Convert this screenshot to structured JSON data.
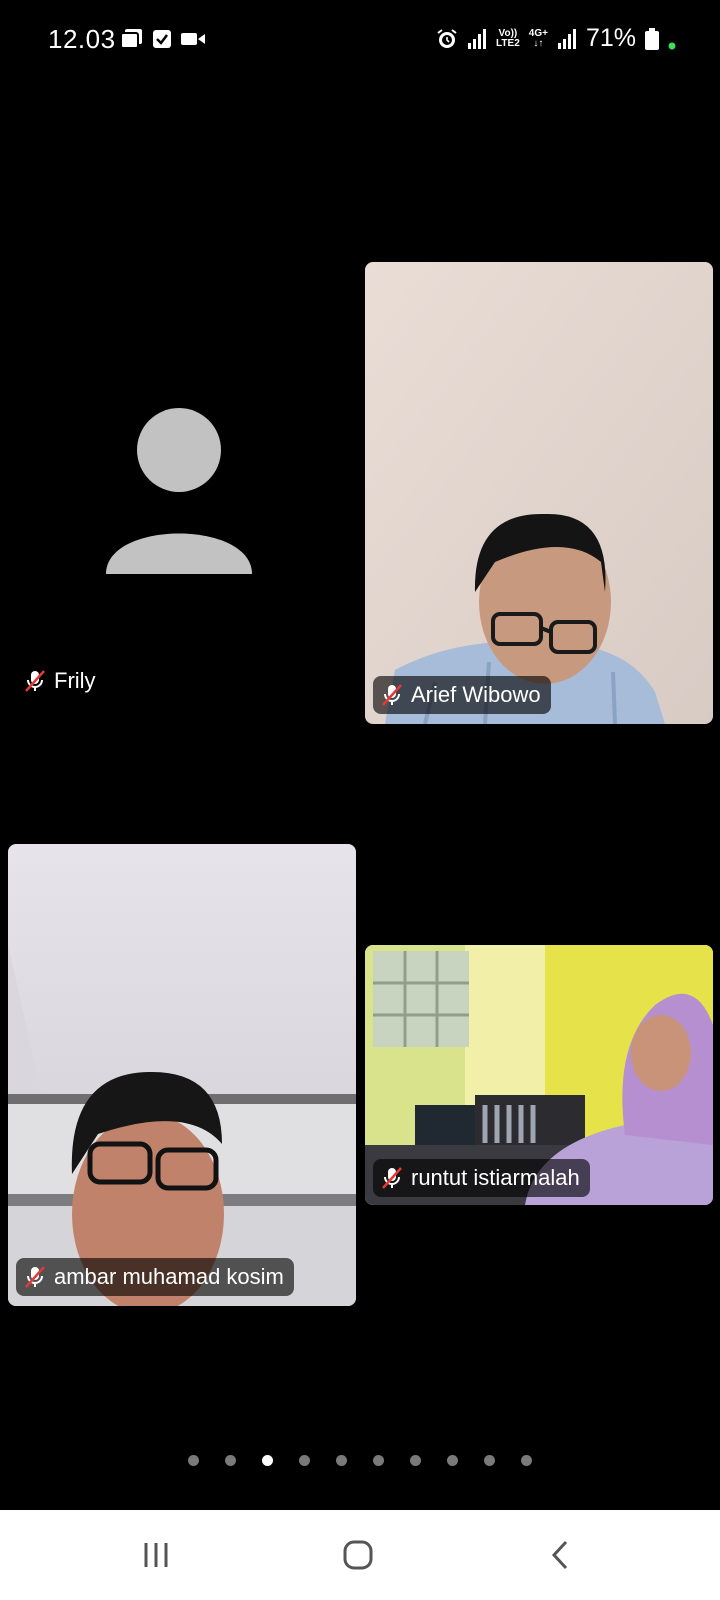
{
  "status_bar": {
    "time": "12.03",
    "lte_label_top": "Vo))",
    "lte_label_bottom": "LTE2",
    "network_top": "4G+",
    "network_bottom": "↓↑",
    "battery": "71%",
    "icons_left": [
      "gallery-icon",
      "checkbox-icon",
      "video-camera-icon"
    ],
    "icons_right": [
      "alarm-icon",
      "signal-icon",
      "signal-icon",
      "battery-icon",
      "active-dot-icon"
    ]
  },
  "participants": [
    {
      "name": "Frily",
      "muted": true,
      "video": false
    },
    {
      "name": "Arief Wibowo",
      "muted": true,
      "video": true
    },
    {
      "name": "ambar muhamad kosim",
      "muted": true,
      "video": true
    },
    {
      "name": "runtut istiarmalah",
      "muted": true,
      "video": true
    }
  ],
  "pagination": {
    "total": 10,
    "active_index": 3
  },
  "nav": {
    "buttons": [
      "recent-apps",
      "home",
      "back"
    ]
  },
  "colors": {
    "background": "#000000",
    "active_dot": "#ffffff",
    "inactive_dot": "#7a7a7a",
    "mic_slash": "#e53935",
    "status_dot": "#3ddc5a"
  }
}
